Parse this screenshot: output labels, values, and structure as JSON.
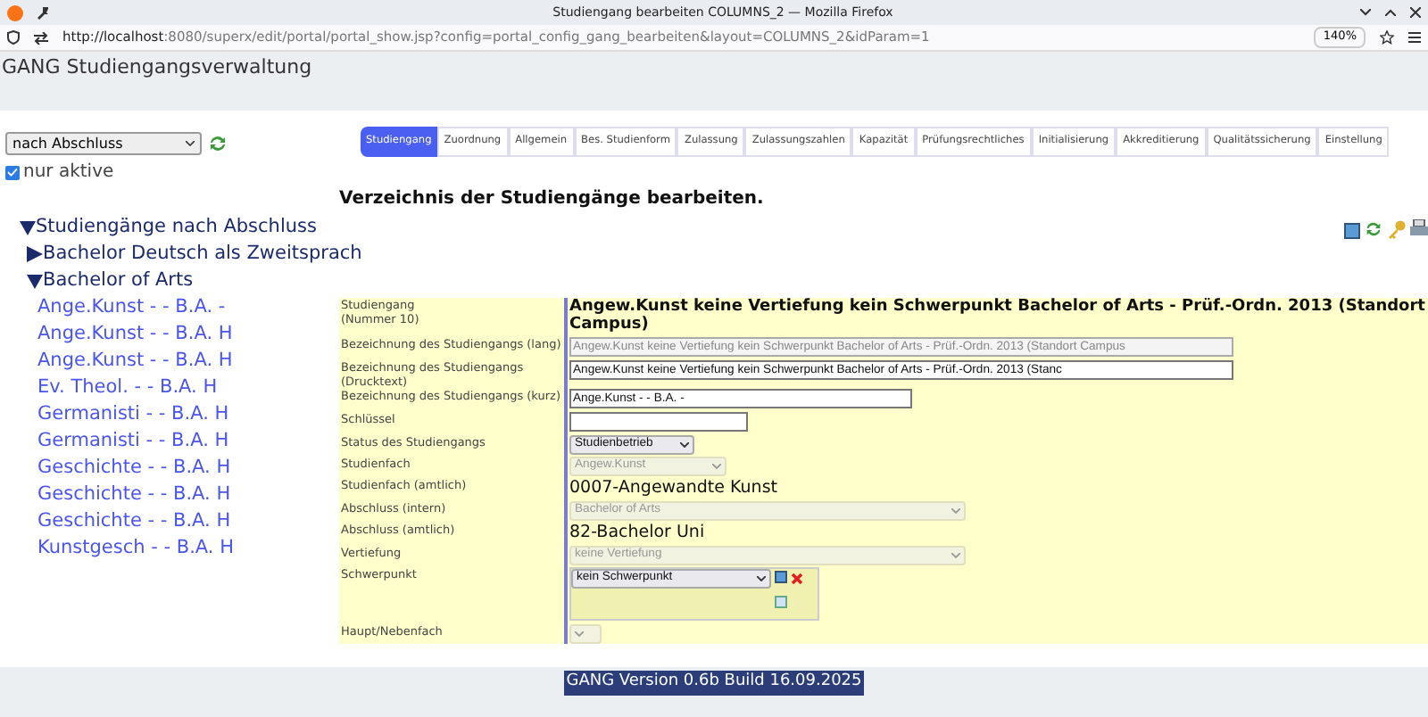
{
  "browser": {
    "title": "Studiengang bearbeiten COLUMNS_2 — Mozilla Firefox",
    "url_host": "http://localhost",
    "url_rest": ":8080/superx/edit/portal/portal_show.jsp?config=portal_config_gang_bearbeiten&layout=COLUMNS_2&idParam=1",
    "zoom": "140%"
  },
  "app_title": "GANG Studiengangsverwaltung",
  "sidebar": {
    "grouping": "nach Abschluss",
    "only_active": {
      "label": "nur aktive",
      "checked": true
    },
    "tree": [
      {
        "label": "Studiengänge nach Abschluss",
        "expanded": true,
        "children": [
          {
            "label": "Bachelor Deutsch als Zweitsprach",
            "expanded": false
          },
          {
            "label": "Bachelor of Arts",
            "expanded": true,
            "children": [
              {
                "label": "Ange.Kunst - - B.A. -"
              },
              {
                "label": "Ange.Kunst - - B.A. H"
              },
              {
                "label": "Ange.Kunst - - B.A. H"
              },
              {
                "label": "Ev. Theol. - - B.A. H"
              },
              {
                "label": "Germanisti - - B.A. H"
              },
              {
                "label": "Germanisti - - B.A. H"
              },
              {
                "label": "Geschichte - - B.A. H"
              },
              {
                "label": "Geschichte - - B.A. H"
              },
              {
                "label": "Geschichte - - B.A. H"
              },
              {
                "label": "Kunstgesch - - B.A. H"
              }
            ]
          }
        ]
      }
    ]
  },
  "tabs": [
    {
      "label": "Studiengang",
      "selected": true
    },
    {
      "label": "Zuordnung",
      "selected": false
    },
    {
      "label": "Allgemein",
      "selected": false
    },
    {
      "label": "Bes. Studienform",
      "selected": false
    },
    {
      "label": "Zulassung",
      "selected": false
    },
    {
      "label": "Zulassungszahlen",
      "selected": false
    },
    {
      "label": "Kapazität",
      "selected": false
    },
    {
      "label": "Prüfungsrechtliches",
      "selected": false
    },
    {
      "label": "Initialisierung",
      "selected": false
    },
    {
      "label": "Akkreditierung",
      "selected": false
    },
    {
      "label": "Qualitätssicherung",
      "selected": false
    },
    {
      "label": "Einstellung",
      "selected": false
    }
  ],
  "heading": "Verzeichnis der Studiengänge bearbeiten.",
  "form": [
    {
      "kind": "title",
      "label": "Studiengang\n(Nummer 10)",
      "value": "Angew.Kunst keine Vertiefung kein Schwerpunkt Bachelor of Arts - Prüf.-Ordn. 2013 (Standort Campus)"
    },
    {
      "kind": "input",
      "label": "Bezeichnung des Studiengangs (lang)",
      "value": "Angew.Kunst keine Vertiefung kein Schwerpunkt Bachelor of Arts - Prüf.-Ordn. 2013 (Standort Campus",
      "disabled": true
    },
    {
      "kind": "input",
      "label": "Bezeichnung des Studiengangs\n(Drucktext)",
      "value": "Angew.Kunst keine Vertiefung kein Schwerpunkt Bachelor of Arts - Prüf.-Ordn. 2013 (Stanc",
      "disabled": false
    },
    {
      "kind": "input",
      "label": "Bezeichnung des Studiengangs (kurz)",
      "value": "Ange.Kunst - - B.A. -",
      "disabled": false
    },
    {
      "kind": "input",
      "label": "Schlüssel",
      "disabled": false
    },
    {
      "kind": "select",
      "label": "Status des Studiengangs",
      "value": "Studienbetrieb",
      "disabled": false
    },
    {
      "kind": "select",
      "label": "Studienfach",
      "value": "Angew.Kunst",
      "disabled": true
    },
    {
      "kind": "text",
      "label": "Studienfach (amtlich)",
      "value": "0007-Angewandte Kunst"
    },
    {
      "kind": "select",
      "label": "Abschluss (intern)",
      "value": "Bachelor of Arts",
      "disabled": true
    },
    {
      "kind": "text",
      "label": "Abschluss (amtlich)",
      "value": "82-Bachelor Uni"
    },
    {
      "kind": "select",
      "label": "Vertiefung",
      "value": "keine Vertiefung",
      "disabled": true
    },
    {
      "kind": "compound",
      "label": "Schwerpunkt",
      "value": "kein Schwerpunkt",
      "disabled": false
    },
    {
      "kind": "select",
      "label": "Haupt/Nebenfach",
      "disabled": true
    }
  ],
  "footer": "GANG Version 0.6b Build 16.09.2025"
}
